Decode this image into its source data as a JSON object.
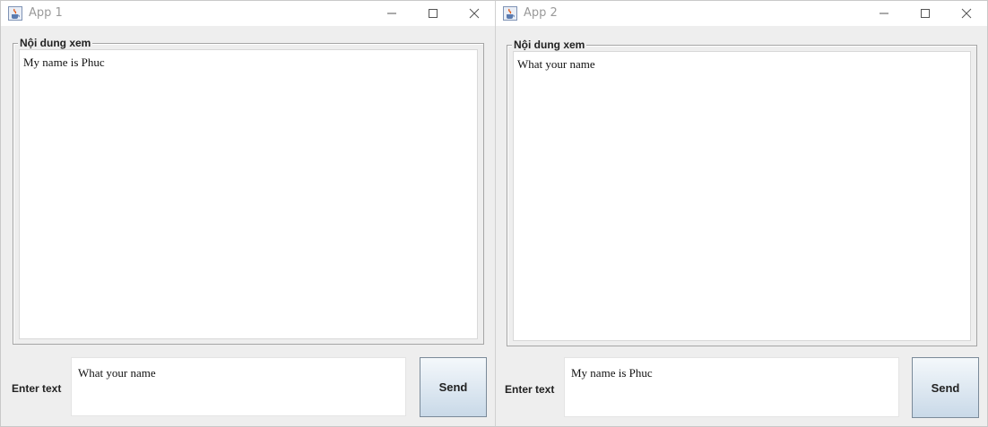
{
  "windows": [
    {
      "title": "App 1",
      "group_title": "Nội dung xem",
      "content_text": "My name is Phuc",
      "input_label": "Enter text",
      "input_value": "What your name",
      "send_label": "Send"
    },
    {
      "title": "App 2",
      "group_title": "Nội dung xem",
      "content_text": "What your name",
      "input_label": "Enter text",
      "input_value": "My name is Phuc",
      "send_label": "Send"
    }
  ],
  "icons": {
    "app": "java-cup-icon",
    "minimize": "minimize-icon",
    "maximize": "maximize-icon",
    "close": "close-icon"
  },
  "colors": {
    "window_bg": "#eeeeee",
    "titlebar_bg": "#ffffff",
    "button_gradient_top": "#f4f8fb",
    "button_gradient_bottom": "#c9d9e8"
  }
}
